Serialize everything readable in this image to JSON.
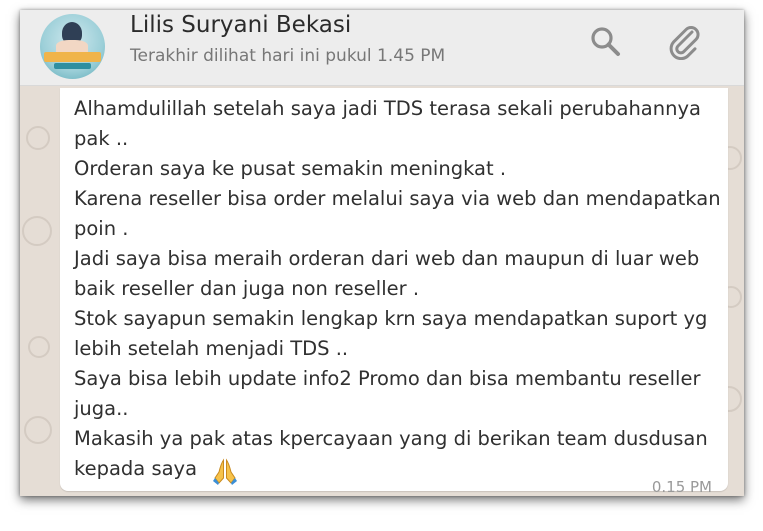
{
  "header": {
    "contact_name": "Lilis Suryani Bekasi",
    "last_seen": "Terakhir dilihat hari ini pukul 1.45 PM",
    "icons": [
      "search-icon",
      "paperclip-icon"
    ]
  },
  "message": {
    "lines": [
      "Alhamdulillah setelah saya jadi TDS terasa sekali perubahannya",
      "pak ..",
      "Orderan saya ke pusat semakin meningkat .",
      "Karena reseller bisa order melalui saya via web dan mendapatkan",
      "poin .",
      "Jadi saya bisa meraih orderan dari web dan maupun di luar web",
      "baik reseller dan juga non reseller .",
      "Stok sayapun semakin lengkap krn saya mendapatkan suport yg",
      "lebih setelah menjadi TDS ..",
      "Saya bisa lebih update info2 Promo dan bisa membantu reseller",
      "juga..",
      "Makasih ya pak atas kpercayaan yang di berikan team dusdusan",
      "kepada saya"
    ],
    "emoji": "folded-hands-emoji",
    "time": "0.15 PM"
  },
  "colors": {
    "header_bg": "#ededed",
    "chat_bg": "#e5ddd5",
    "bubble_bg": "#ffffff",
    "icon_gray": "#8c8c8c"
  }
}
